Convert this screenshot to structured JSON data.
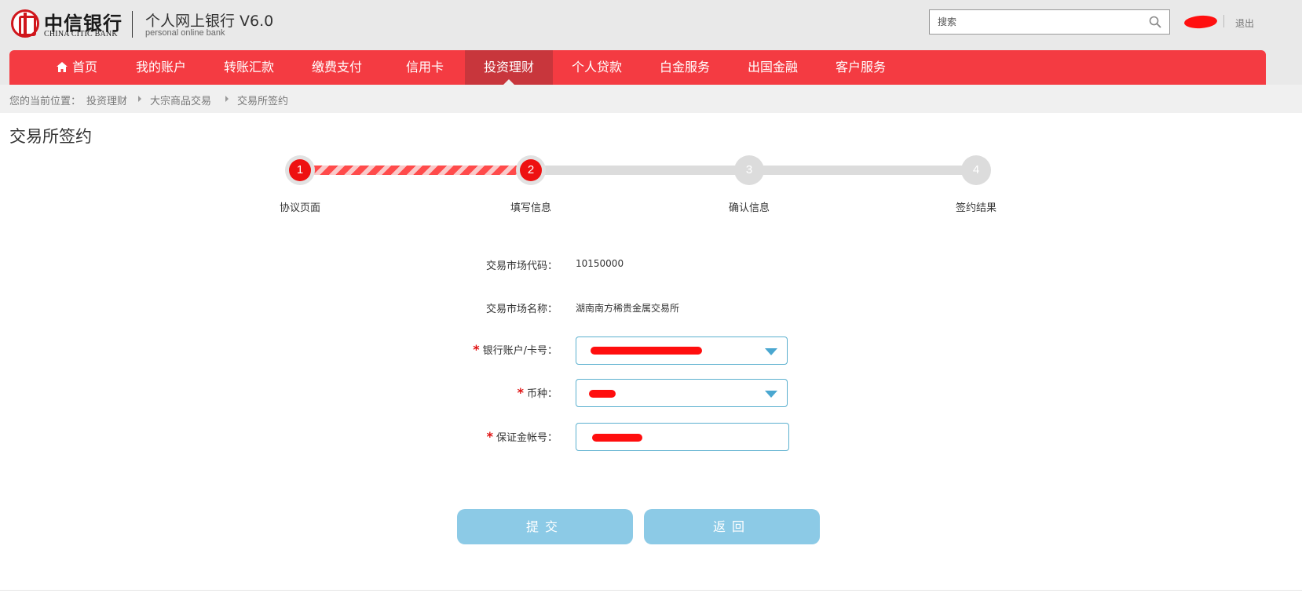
{
  "header": {
    "logo_cn": "中信银行",
    "logo_en": "CHINA CITIC BANK",
    "product_title": "个人网上银行 V6.0",
    "product_subtitle": "personal online bank",
    "search_placeholder": "搜索",
    "logout_label": "退出"
  },
  "nav": {
    "items": [
      {
        "label": "首页"
      },
      {
        "label": "我的账户"
      },
      {
        "label": "转账汇款"
      },
      {
        "label": "缴费支付"
      },
      {
        "label": "信用卡"
      },
      {
        "label": "投资理财"
      },
      {
        "label": "个人贷款"
      },
      {
        "label": "白金服务"
      },
      {
        "label": "出国金融"
      },
      {
        "label": "客户服务"
      }
    ],
    "active_index": 5
  },
  "breadcrumb": {
    "prefix": "您的当前位置：",
    "items": [
      "投资理财",
      "大宗商品交易",
      "交易所签约"
    ]
  },
  "page_title": "交易所签约",
  "steps": [
    {
      "number": "1",
      "label": "协议页面",
      "state": "done"
    },
    {
      "number": "2",
      "label": "填写信息",
      "state": "current"
    },
    {
      "number": "3",
      "label": "确认信息",
      "state": "pending"
    },
    {
      "number": "4",
      "label": "签约结果",
      "state": "pending"
    }
  ],
  "form": {
    "market_code_label": "交易市场代码：",
    "market_code_value": "10150000",
    "market_name_label": "交易市场名称：",
    "market_name_value": "湖南南方稀贵金属交易所",
    "account_label": "银行账户/卡号：",
    "currency_label": "币种：",
    "margin_account_label": "保证金帐号：",
    "required_mark": "*"
  },
  "buttons": {
    "submit": "提交",
    "back": "返回"
  },
  "colors": {
    "nav_bg": "#f43b42",
    "nav_active": "#c8363c",
    "step_done": "#ee1111",
    "button_bg": "#8ccae6",
    "field_border": "#5bb0cf"
  }
}
